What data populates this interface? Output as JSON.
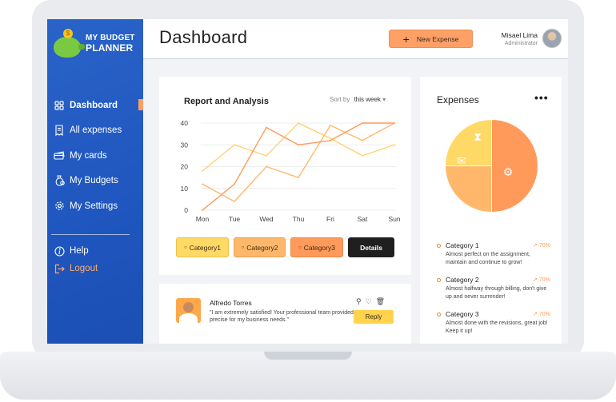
{
  "app": {
    "logo_line1": "MY BUDGET",
    "logo_line2": "PLANNER",
    "logo_coin": "$"
  },
  "sidebar": {
    "items": [
      {
        "label": "Dashboard",
        "icon": "grid-icon",
        "active": true
      },
      {
        "label": "All expenses",
        "icon": "receipt-icon"
      },
      {
        "label": "My cards",
        "icon": "cards-icon"
      },
      {
        "label": "My Budgets",
        "icon": "money-bag-icon"
      },
      {
        "label": "My Settings",
        "icon": "gear-icon"
      }
    ],
    "bottom": [
      {
        "label": "Help",
        "icon": "info-icon"
      },
      {
        "label": "Logout",
        "icon": "logout-icon"
      }
    ]
  },
  "header": {
    "title": "Dashboard",
    "new_button": "New Expense",
    "user_name": "Misael Lima",
    "user_role": "Administrator"
  },
  "report": {
    "title": "Report and Analysis",
    "sort_label": "Sort by",
    "sort_value": "this week",
    "buttons": [
      "Category1",
      "Category2",
      "Category3",
      "Details"
    ]
  },
  "chart_data": {
    "type": "line",
    "categories": [
      "Mon",
      "Tue",
      "Wed",
      "Thu",
      "Fri",
      "Sat",
      "Sun"
    ],
    "ylim": [
      0,
      40
    ],
    "yticks": [
      0,
      10,
      20,
      30,
      40
    ],
    "series": [
      {
        "values": [
          18,
          30,
          25,
          40,
          33,
          25,
          30
        ],
        "color": "#ffd36b"
      },
      {
        "values": [
          12,
          4,
          20,
          15,
          39,
          32,
          40
        ],
        "color": "#ffb86b"
      },
      {
        "values": [
          0,
          12,
          38,
          30,
          32,
          40,
          40
        ],
        "color": "#ff9a5a"
      }
    ]
  },
  "review": {
    "name": "Alfredo Torres",
    "text": "\"I am extremely satisfied! Your professional team provided precise for my business needs.\"",
    "reply": "Reply"
  },
  "expenses": {
    "title": "Expenses",
    "menu": "•••",
    "pie": [
      {
        "value": 50,
        "color": "#ff9a5a"
      },
      {
        "value": 25,
        "color": "#ffb86b"
      },
      {
        "value": 25,
        "color": "#ffd966"
      }
    ],
    "categories": [
      {
        "name": "Category 1",
        "pct": "70%",
        "desc": "Almost perfect on the assignment, maintain and continue to grow!"
      },
      {
        "name": "Category 2",
        "pct": "70%",
        "desc": "Almost halfway through billing, don't give up and never surrender!"
      },
      {
        "name": "Category 3",
        "pct": "70%",
        "desc": "Almost done with the revisions, great job! Keep it up!"
      }
    ]
  }
}
